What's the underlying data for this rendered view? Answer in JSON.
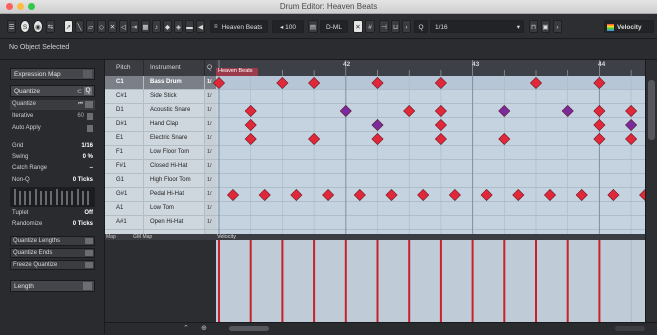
{
  "window": {
    "title": "Drum Editor: Heaven Beats"
  },
  "toolbar": {
    "part_name": "Heaven Beats",
    "volume": "100",
    "drum_map_short": "D-ML",
    "quantize": "1/16",
    "velocity_label": "Velocity",
    "icons": [
      "solo-icon",
      "mute-icon",
      "info-icon",
      "autoscroll-icon",
      "pointer-icon",
      "drumstick-icon",
      "eraser-icon",
      "zoom-icon",
      "mute-tool-icon",
      "speaker-icon",
      "snap-icon",
      "grid-icon",
      "quantize-grid-icon",
      "color-icon"
    ]
  },
  "info_line": {
    "text": "No Object Selected"
  },
  "inspector": {
    "expression_map": "Expression Map",
    "quantize_section": "Quantize",
    "quantize_label": "Quantize",
    "iterative_label": "Iterative",
    "iterative_value": "60",
    "auto_apply_label": "Auto Apply",
    "grid_label": "Grid",
    "grid_value": "1/16",
    "swing_label": "Swing",
    "swing_value": "0 %",
    "catch_range_label": "Catch Range",
    "non_q_label": "Non-Q",
    "non_q_value": "0 Ticks",
    "tuplet_label": "Tuplet",
    "tuplet_value": "Off",
    "randomize_label": "Randomize",
    "randomize_value": "0 Ticks",
    "quantize_lengths": "Quantize Lengths",
    "quantize_ends": "Quantize Ends",
    "freeze_quantize": "Freeze Quantize",
    "length_section": "Length"
  },
  "list_header": {
    "pitch": "Pitch",
    "instrument": "Instrument",
    "q": "Q"
  },
  "ruler": {
    "part_label": "Heaven Beats",
    "bars": [
      "42",
      "43",
      "44"
    ]
  },
  "drum_rows": [
    {
      "pitch": "C1",
      "instrument": "Bass Drum",
      "q": "1/"
    },
    {
      "pitch": "C#1",
      "instrument": "Side Stick",
      "q": "1/"
    },
    {
      "pitch": "D1",
      "instrument": "Acoustic Snare",
      "q": "1/"
    },
    {
      "pitch": "D#1",
      "instrument": "Hand Clap",
      "q": "1/"
    },
    {
      "pitch": "E1",
      "instrument": "Electric Snare",
      "q": "1/"
    },
    {
      "pitch": "F1",
      "instrument": "Low Floor Tom",
      "q": "1/"
    },
    {
      "pitch": "F#1",
      "instrument": "Closed Hi-Hat",
      "q": "1/"
    },
    {
      "pitch": "G1",
      "instrument": "High Floor Tom",
      "q": "1/"
    },
    {
      "pitch": "G#1",
      "instrument": "Pedal Hi-Hat",
      "q": "1/"
    },
    {
      "pitch": "A1",
      "instrument": "Low Tom",
      "q": "1/"
    },
    {
      "pitch": "A#1",
      "instrument": "Open Hi-Hat",
      "q": "1/"
    }
  ],
  "bottom_header": {
    "map_label": "Map",
    "gm_map": "GM Map",
    "velocity": "Velocity"
  },
  "colors": {
    "note_red": "#e0283a",
    "note_purple": "#7a2a9a",
    "lane": "#c5d3e0",
    "selected_row": "#7b8088",
    "velocity_bar": "#c8202c"
  }
}
